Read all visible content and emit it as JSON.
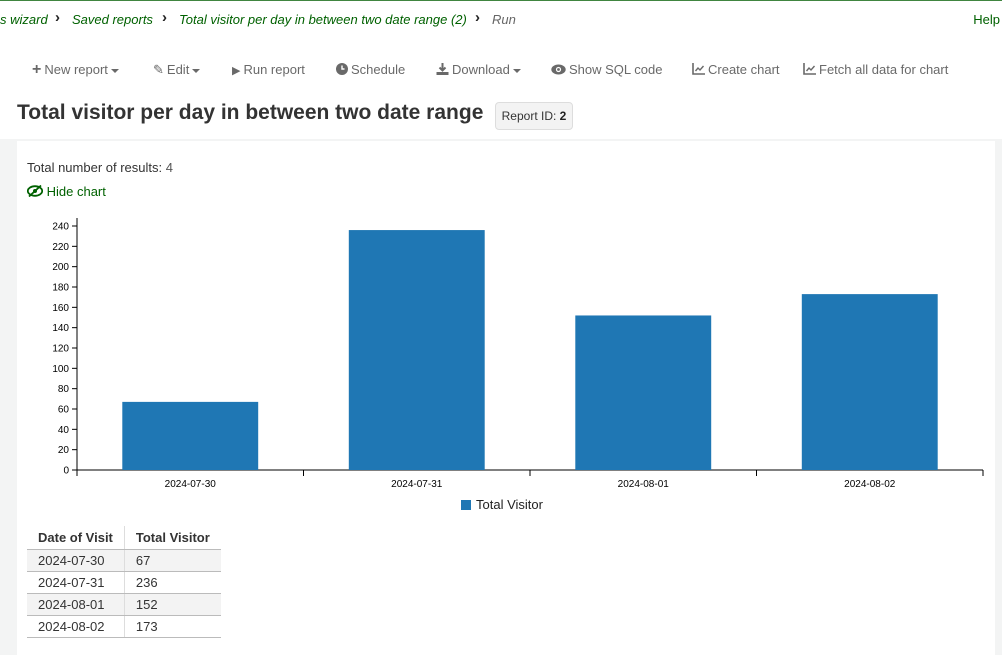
{
  "breadcrumb": {
    "items": [
      {
        "label": "s wizard"
      },
      {
        "label": "Saved reports"
      },
      {
        "label": "Total visitor per day in between two date range (2)"
      },
      {
        "label": "Run"
      }
    ],
    "help": "Help"
  },
  "toolbar": {
    "new_report": "New report",
    "edit": "Edit",
    "run_report": "Run report",
    "schedule": "Schedule",
    "download": "Download",
    "show_sql": "Show SQL code",
    "create_chart": "Create chart",
    "fetch_all": "Fetch all data for chart"
  },
  "report": {
    "title": "Total visitor per day in between two date range",
    "id_label": "Report ID:",
    "id_value": "2",
    "total_label": "Total number of results:",
    "total_value": "4",
    "hide_chart": "Hide chart"
  },
  "colors": {
    "bar": "#1f77b4",
    "link": "#006100"
  },
  "chart_data": {
    "type": "bar",
    "categories": [
      "2024-07-30",
      "2024-07-31",
      "2024-08-01",
      "2024-08-02"
    ],
    "series": [
      {
        "name": "Total Visitor",
        "values": [
          67,
          236,
          152,
          173
        ]
      }
    ],
    "ylim": [
      0,
      240
    ],
    "yticks": [
      0,
      20,
      40,
      60,
      80,
      100,
      120,
      140,
      160,
      180,
      200,
      220,
      240
    ],
    "legend": "bottom-center",
    "grid": false
  },
  "table": {
    "headers": [
      "Date of Visit",
      "Total Visitor"
    ],
    "rows": [
      [
        "2024-07-30",
        "67"
      ],
      [
        "2024-07-31",
        "236"
      ],
      [
        "2024-08-01",
        "152"
      ],
      [
        "2024-08-02",
        "173"
      ]
    ]
  }
}
